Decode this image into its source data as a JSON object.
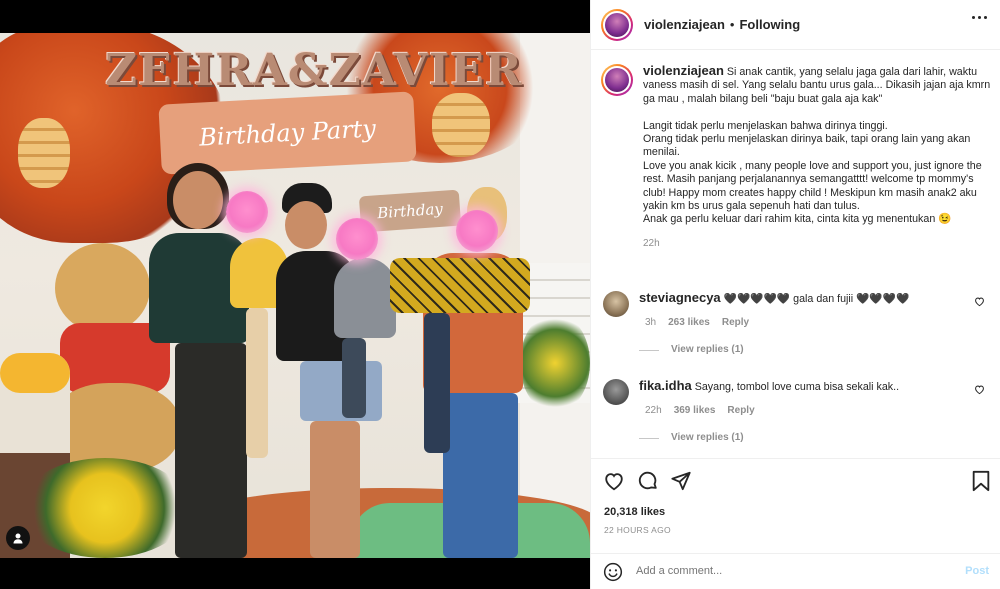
{
  "photo": {
    "sign_text": "ZEHRA&ZAVIER",
    "banner_text": "Birthday Party",
    "banner2_text": "Birthday"
  },
  "header": {
    "username": "violenziajean",
    "separator": "•",
    "follow_state": "Following"
  },
  "caption": {
    "username": "violenziajean",
    "text": " Si anak cantik, yang selalu jaga gala dari lahir, waktu vaness masih di sel. Yang selalu bantu urus gala... Dikasih jajan aja kmrn ga mau , malah bilang beli \"baju buat gala aja kak\"\n\nLangit tidak perlu menjelaskan bahwa dirinya tinggi.\nOrang tidak perlu menjelaskan dirinya baik, tapi orang lain yang akan menilai.\nLove you anak kicik , many people love and support you, just ignore the rest. Masih panjang perjalanannya semangatttt! welcome tp mommy's club! Happy mom creates happy child ! Meskipun km masih anak2 aku yakin km bs urus gala sepenuh hati dan tulus.\nAnak ga perlu keluar dari rahim kita, cinta kita yg menentukan 😉",
    "time": "22h"
  },
  "comments": [
    {
      "username": "steviagnecya",
      "text": " 🖤🖤🖤🖤🖤 gala dan fujii 🖤🖤🖤🖤",
      "time": "3h",
      "likes": "263 likes",
      "reply": "Reply",
      "view_replies": "View replies (1)"
    },
    {
      "username": "fika.idha",
      "text": " Sayang, tombol love cuma bisa sekali kak..",
      "time": "22h",
      "likes": "369 likes",
      "reply": "Reply",
      "view_replies": "View replies (1)"
    }
  ],
  "stats": {
    "likes": "20,318 likes",
    "posted": "22 HOURS AGO"
  },
  "add_comment": {
    "placeholder": "Add a comment...",
    "post_label": "Post"
  },
  "icons": {
    "like": "heart-icon",
    "comment": "comment-bubble-icon",
    "share": "paper-plane-icon",
    "save": "bookmark-icon",
    "emoji": "smiley-icon",
    "options": "ellipsis-icon",
    "tag": "user-tag-icon"
  },
  "colors": {
    "post_button_disabled": "#b2dffc",
    "secondary_text": "#8e8e8e",
    "primary_text": "#262626"
  }
}
